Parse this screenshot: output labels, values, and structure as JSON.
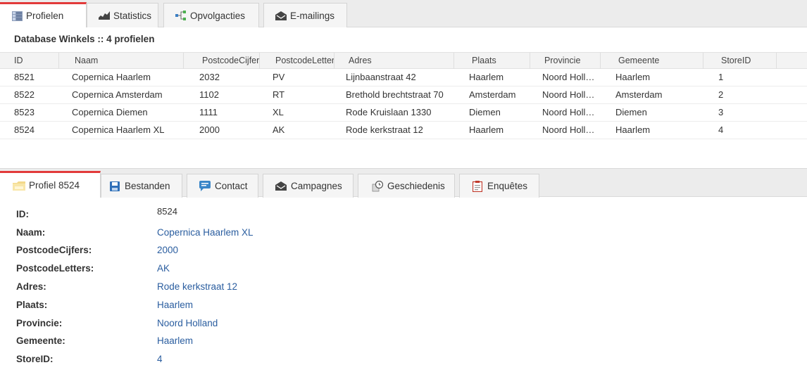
{
  "top_tabs": [
    {
      "label": "Profielen"
    },
    {
      "label": "Statistics"
    },
    {
      "label": "Opvolgacties"
    },
    {
      "label": "E-mailings"
    }
  ],
  "database_title": "Database Winkels :: 4 profielen",
  "grid": {
    "columns": [
      "ID",
      "Naam",
      "PostcodeCijfers",
      "PostcodeLetters",
      "Adres",
      "Plaats",
      "Provincie",
      "Gemeente",
      "StoreID"
    ],
    "rows": [
      [
        "8521",
        "Copernica Haarlem",
        "2032",
        "PV",
        "Lijnbaanstraat 42",
        "Haarlem",
        "Noord Holland",
        "Haarlem",
        "1"
      ],
      [
        "8522",
        "Copernica Amsterdam",
        "1102",
        "RT",
        "Brethold brechtstraat 70",
        "Amsterdam",
        "Noord Holland",
        "Amsterdam",
        "2"
      ],
      [
        "8523",
        "Copernica Diemen",
        "1111",
        "XL",
        "Rode Kruislaan 1330",
        "Diemen",
        "Noord Holland",
        "Diemen",
        "3"
      ],
      [
        "8524",
        "Copernica Haarlem XL",
        "2000",
        "AK",
        "Rode kerkstraat 12",
        "Haarlem",
        "Noord Holland",
        "Haarlem",
        "4"
      ]
    ]
  },
  "bottom_tabs": [
    {
      "label": "Profiel 8524"
    },
    {
      "label": "Bestanden"
    },
    {
      "label": "Contact"
    },
    {
      "label": "Campagnes"
    },
    {
      "label": "Geschiedenis"
    },
    {
      "label": "Enquêtes"
    }
  ],
  "profile_fields": [
    {
      "label": "ID:",
      "value": "8524"
    },
    {
      "label": "Naam:",
      "value": "Copernica Haarlem XL"
    },
    {
      "label": "PostcodeCijfers:",
      "value": "2000"
    },
    {
      "label": "PostcodeLetters:",
      "value": "AK"
    },
    {
      "label": "Adres:",
      "value": "Rode kerkstraat 12"
    },
    {
      "label": "Plaats:",
      "value": "Haarlem"
    },
    {
      "label": "Provincie:",
      "value": "Noord Holland"
    },
    {
      "label": "Gemeente:",
      "value": "Haarlem"
    },
    {
      "label": "StoreID:",
      "value": "4"
    }
  ],
  "colors": {
    "accent": "#e23a3a",
    "link": "#2a5d9f"
  }
}
